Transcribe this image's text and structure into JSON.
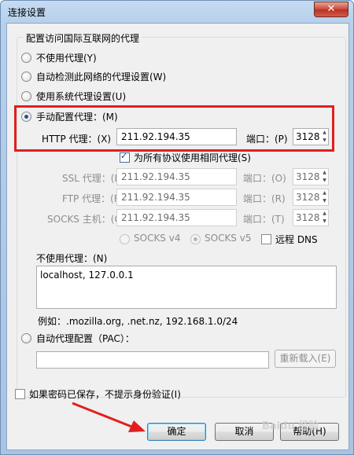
{
  "window": {
    "title": "连接设置",
    "close": "✕"
  },
  "group_title": "配置访问国际互联网的代理",
  "options": {
    "no_proxy": "不使用代理(Y)",
    "auto_detect": "自动检测此网络的代理设置(W)",
    "system": "使用系统代理设置(U)",
    "manual": "手动配置代理：(M)"
  },
  "manual": {
    "http_label": "HTTP 代理：(X)",
    "http_host": "211.92.194.35",
    "port_label": "端口：(P)",
    "http_port": "3128",
    "share_label": "为所有协议使用相同代理(S)",
    "ssl_label": "SSL 代理：(L)",
    "ssl_host": "211.92.194.35",
    "ssl_port_label": "端口：(O)",
    "ssl_port": "3128",
    "ftp_label": "FTP 代理：(F)",
    "ftp_host": "211.92.194.35",
    "ftp_port_label": "端口：(R)",
    "ftp_port": "3128",
    "socks_label": "SOCKS 主机：(C)",
    "socks_host": "211.92.194.35",
    "socks_port_label": "端口：(T)",
    "socks_port": "3128",
    "socks4": "SOCKS v4",
    "socks5": "SOCKS v5",
    "remote_dns": "远程 DNS"
  },
  "no_proxy_for": {
    "label": "不使用代理：(N)",
    "value": "localhost, 127.0.0.1",
    "example": "例如：.mozilla.org, .net.nz, 192.168.1.0/24"
  },
  "pac": {
    "label": "自动代理配置（PAC）：",
    "url": "",
    "reload": "重新载入(E)"
  },
  "no_auth_prompt": "如果密码已保存，不提示身份验证(I)",
  "buttons": {
    "ok": "确定",
    "cancel": "取消",
    "help": "帮助(H)"
  },
  "watermark": "Baidu 经验"
}
